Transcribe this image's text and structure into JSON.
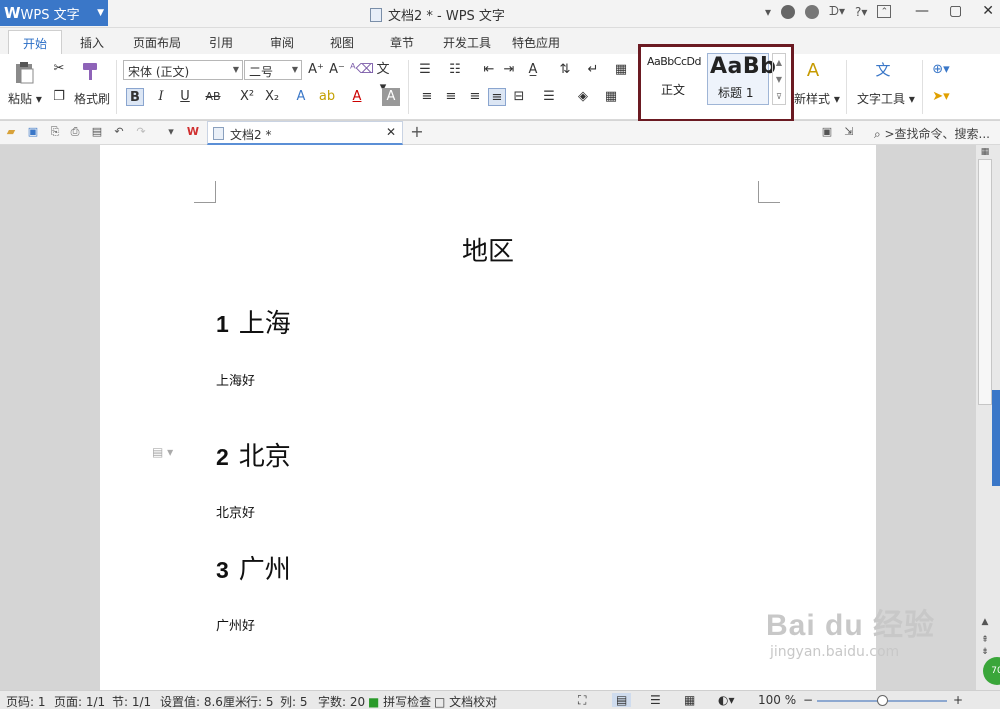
{
  "app": {
    "button_label": "WPS 文字",
    "logo_letter": "W"
  },
  "window": {
    "title": "文档2 * - WPS 文字",
    "controls": [
      "minimize-icon",
      "maximize-icon",
      "close-icon"
    ]
  },
  "menu_tabs": [
    "开始",
    "插入",
    "页面布局",
    "引用",
    "审阅",
    "视图",
    "章节",
    "开发工具",
    "特色应用"
  ],
  "ribbon": {
    "paste_label": "粘贴",
    "format_painter_label": "格式刷",
    "font_name": "宋体 (正文)",
    "font_size": "二号",
    "styles": [
      {
        "preview": "AaBbCcDd",
        "label": "正文"
      },
      {
        "preview": "AaBb",
        "label": "标题 1"
      }
    ],
    "new_style_label": "新样式",
    "text_tools_label": "文字工具",
    "styles_box_color": "#6b1a22"
  },
  "quick_access": {
    "doc_tab": "文档2 *",
    "search_label": ">查找命令、搜索..."
  },
  "document": {
    "title": "地区",
    "sections": [
      {
        "num": "1",
        "heading": "上海",
        "body": "上海好"
      },
      {
        "num": "2",
        "heading": "北京",
        "body": "北京好"
      },
      {
        "num": "3",
        "heading": "广州",
        "body": "广州好"
      }
    ]
  },
  "watermark": {
    "top": "Bai du 经验",
    "bottom": "jingyan.baidu.com"
  },
  "side_badge": "70",
  "status": {
    "page_code": "页码: 1",
    "page": "页面: 1/1",
    "section": "节: 1/1",
    "setting": "设置值: 8.6厘米",
    "row": "行: 5",
    "col": "列: 5",
    "word_count": "字数: 20",
    "spell_check": "拼写检查",
    "doc_check": "文档校对",
    "zoom": "100 %",
    "zoom_level": 0.5
  }
}
